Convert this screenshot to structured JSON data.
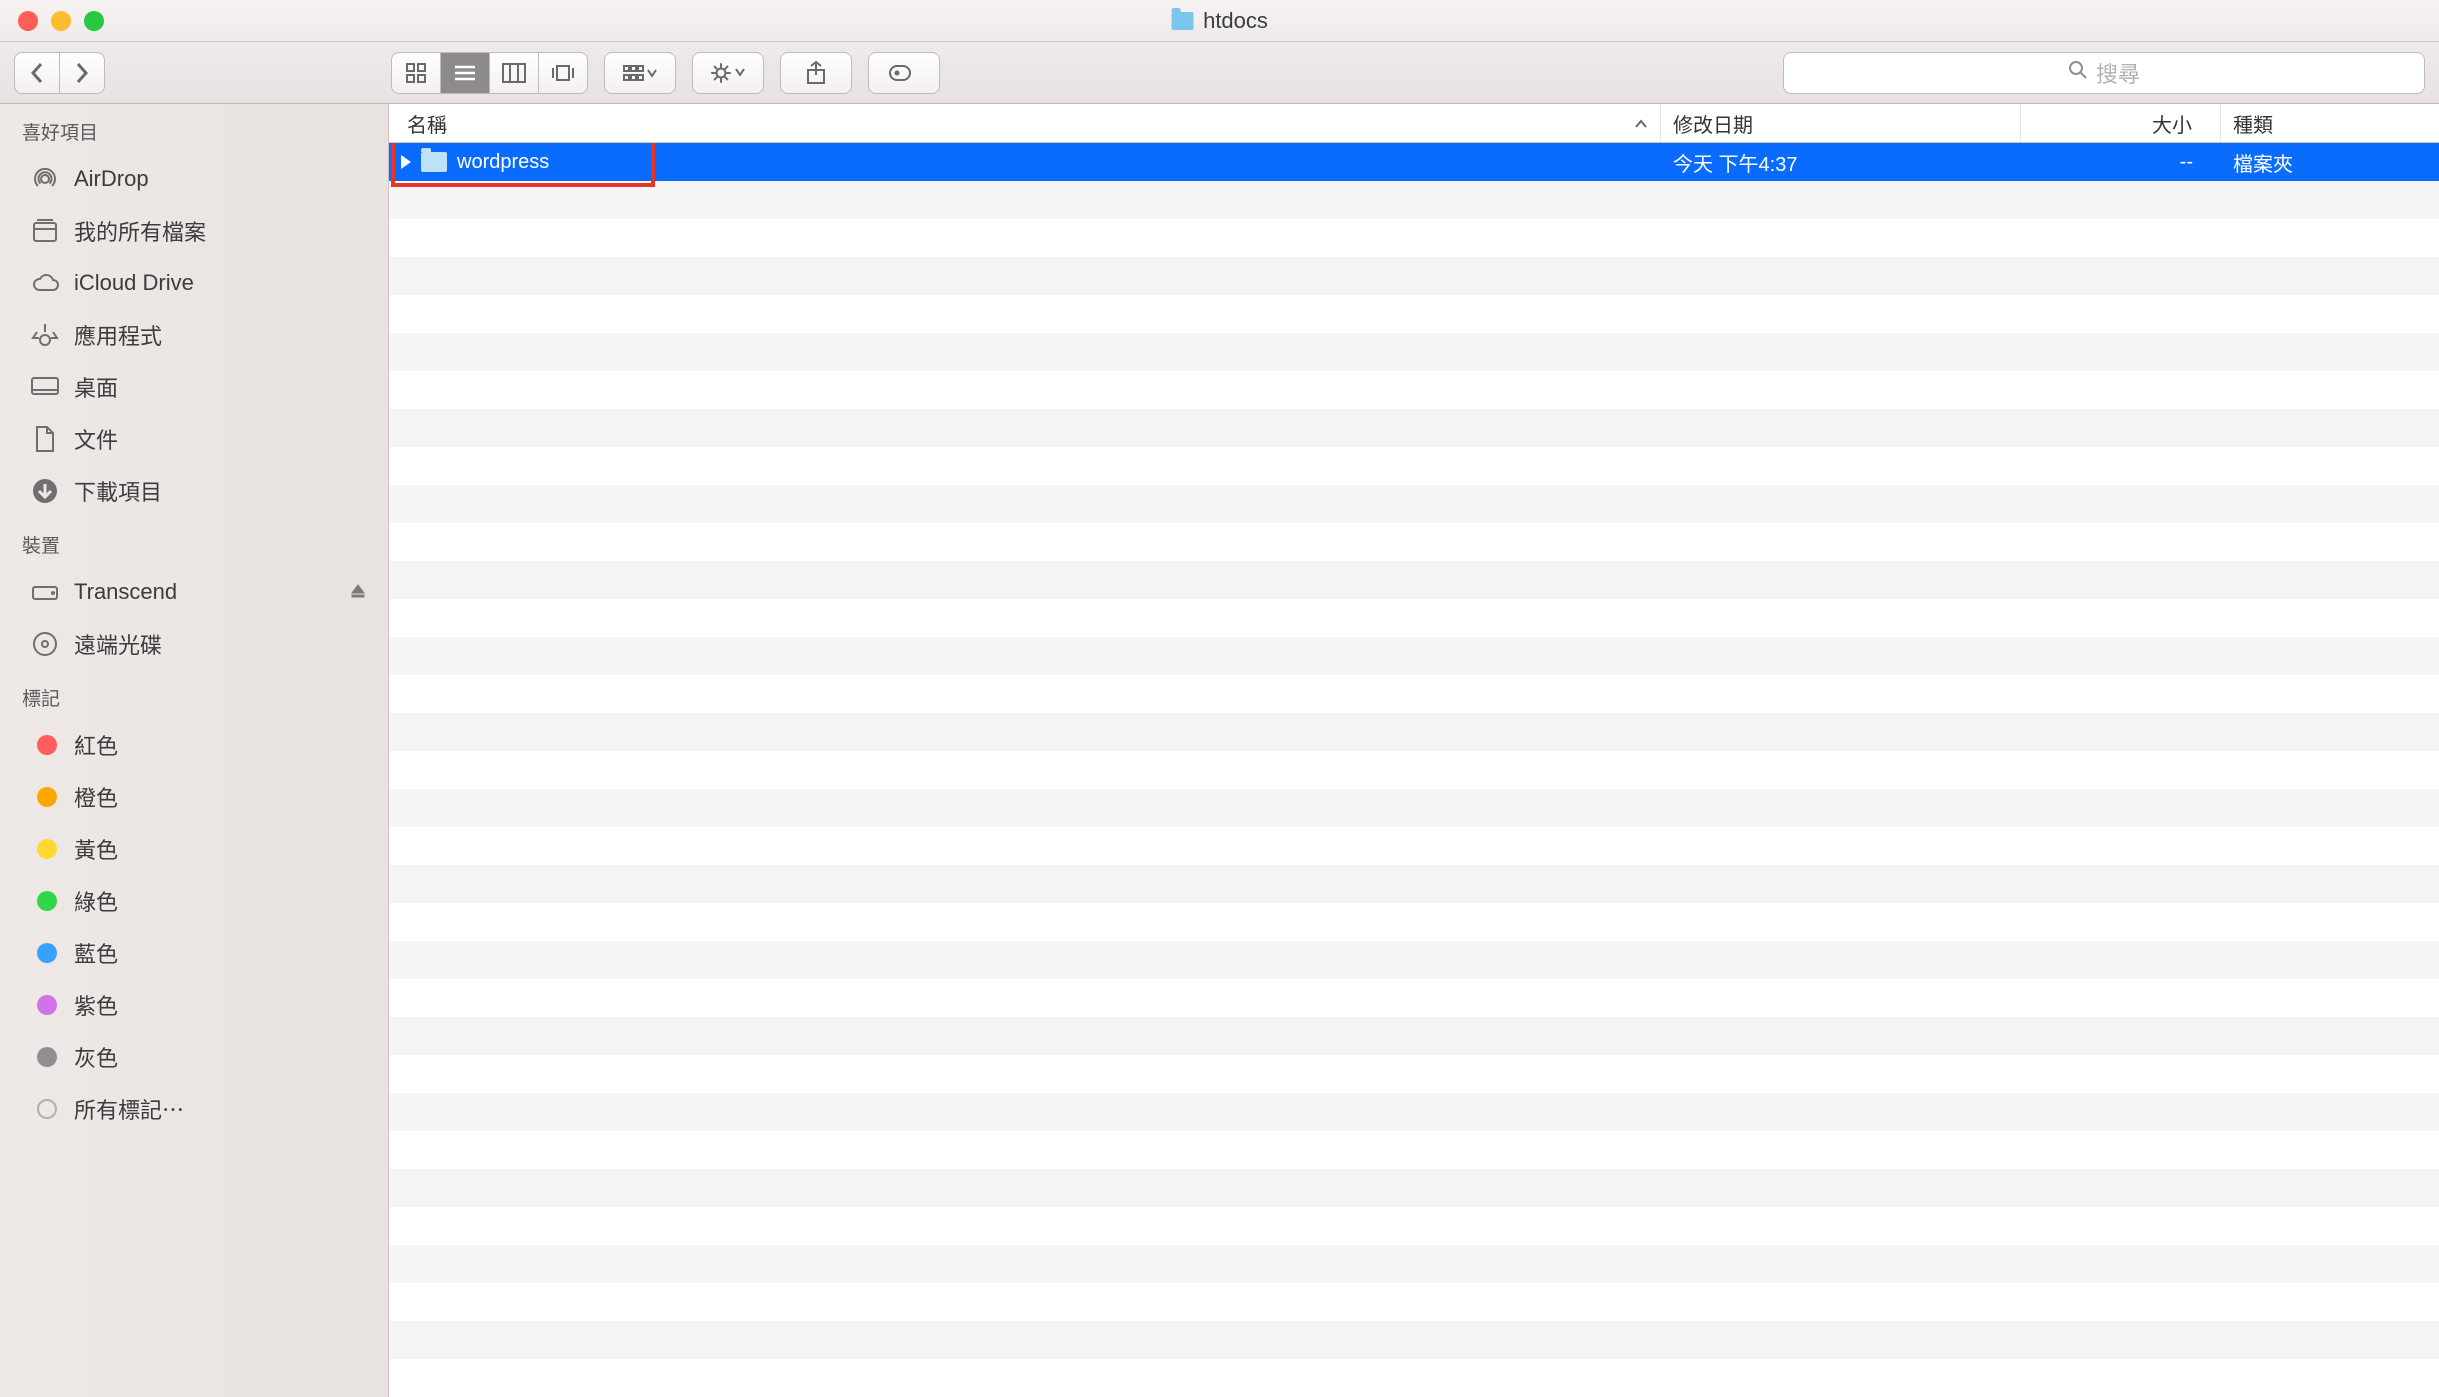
{
  "window": {
    "title": "htdocs"
  },
  "toolbar": {
    "search_placeholder": "搜尋"
  },
  "sidebar": {
    "sections": [
      {
        "heading": "喜好項目",
        "items": [
          {
            "id": "airdrop",
            "label": "AirDrop",
            "icon": "airdrop"
          },
          {
            "id": "allfiles",
            "label": "我的所有檔案",
            "icon": "allfiles"
          },
          {
            "id": "icloud",
            "label": "iCloud Drive",
            "icon": "cloud"
          },
          {
            "id": "apps",
            "label": "應用程式",
            "icon": "apps"
          },
          {
            "id": "desktop",
            "label": "桌面",
            "icon": "desktop"
          },
          {
            "id": "documents",
            "label": "文件",
            "icon": "document"
          },
          {
            "id": "downloads",
            "label": "下載項目",
            "icon": "download"
          }
        ]
      },
      {
        "heading": "裝置",
        "items": [
          {
            "id": "transcend",
            "label": "Transcend",
            "icon": "drive",
            "ejectable": true
          },
          {
            "id": "remotedisc",
            "label": "遠端光碟",
            "icon": "disc"
          }
        ]
      },
      {
        "heading": "標記",
        "items": [
          {
            "id": "tag-red",
            "label": "紅色",
            "icon": "tag",
            "color": "#ff5d5b"
          },
          {
            "id": "tag-orange",
            "label": "橙色",
            "icon": "tag",
            "color": "#ffa600"
          },
          {
            "id": "tag-yellow",
            "label": "黃色",
            "icon": "tag",
            "color": "#ffd932"
          },
          {
            "id": "tag-green",
            "label": "綠色",
            "icon": "tag",
            "color": "#31d74b"
          },
          {
            "id": "tag-blue",
            "label": "藍色",
            "icon": "tag",
            "color": "#38a1ff"
          },
          {
            "id": "tag-purple",
            "label": "紫色",
            "icon": "tag",
            "color": "#cf73e6"
          },
          {
            "id": "tag-gray",
            "label": "灰色",
            "icon": "tag",
            "color": "#8e8e93"
          },
          {
            "id": "tag-all",
            "label": "所有標記⋯",
            "icon": "tag-outline"
          }
        ]
      }
    ]
  },
  "columns": {
    "name": "名稱",
    "date": "修改日期",
    "size": "大小",
    "kind": "種類"
  },
  "rows": [
    {
      "name": "wordpress",
      "date": "今天 下午4:37",
      "size": "--",
      "kind": "檔案夾",
      "selected": true,
      "highlighted": true
    }
  ],
  "empty_row_count": 32
}
